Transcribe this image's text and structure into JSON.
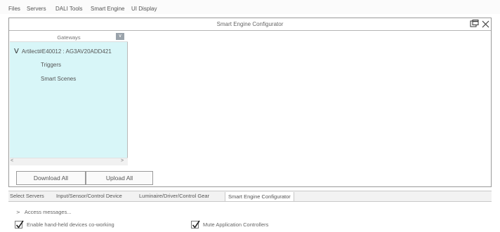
{
  "menu": {
    "items": [
      "Files",
      "Servers",
      "DALI Tools",
      "Smart Engine",
      "UI Display"
    ]
  },
  "window": {
    "title": "Smart Engine Configurator"
  },
  "tree": {
    "header": "Gateways",
    "header_button": "∨",
    "root_label": "Artilect#E40012 : AG3AV20ADD421",
    "children": [
      "Triggers",
      "Smart Scenes"
    ]
  },
  "buttons": {
    "download_all": "Download All",
    "upload_all": "Upload All"
  },
  "tabs": [
    "Select Servers",
    "Input/Sensor/Control Device",
    "Luminaire/Driver/Control Gear",
    "Smart Engine Configurator"
  ],
  "bottom": {
    "access_messages": "Access messages...",
    "checkbox1_label": "Enable hand-held devices co-working",
    "checkbox1_checked": true,
    "checkbox2_label": "Mute Application Controllers",
    "checkbox2_checked": true
  }
}
